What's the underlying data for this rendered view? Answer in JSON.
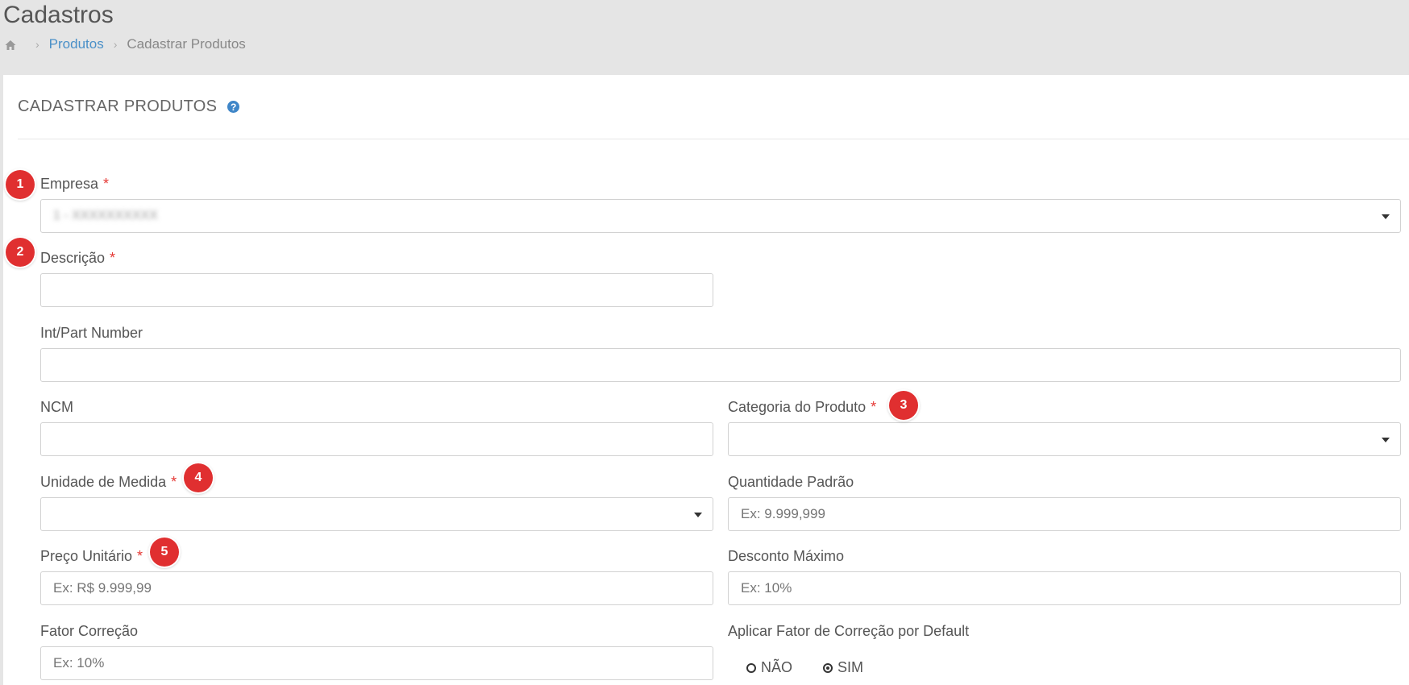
{
  "header": {
    "title": "Cadastros",
    "breadcrumb": {
      "link": "Produtos",
      "current": "Cadastrar Produtos"
    }
  },
  "panel": {
    "title": "CADASTRAR PRODUTOS",
    "help_glyph": "?"
  },
  "fields": {
    "empresa": {
      "label": "Empresa",
      "value": "1 - XXXXXXXXXX",
      "badge": "1"
    },
    "descricao": {
      "label": "Descrição",
      "placeholder": "",
      "badge": "2"
    },
    "part_number": {
      "label": "Int/Part Number",
      "placeholder": ""
    },
    "ncm": {
      "label": "NCM",
      "placeholder": ""
    },
    "categoria": {
      "label": "Categoria do Produto",
      "value": "",
      "badge": "3"
    },
    "unidade": {
      "label": "Unidade de Medida",
      "value": "",
      "badge": "4"
    },
    "quantidade": {
      "label": "Quantidade Padrão",
      "placeholder": "Ex: 9.999,999"
    },
    "preco": {
      "label": "Preço Unitário",
      "placeholder": "Ex: R$ 9.999,99",
      "badge": "5"
    },
    "desconto": {
      "label": "Desconto Máximo",
      "placeholder": "Ex: 10%"
    },
    "fator": {
      "label": "Fator Correção",
      "placeholder": "Ex: 10%"
    },
    "aplicar": {
      "label": "Aplicar Fator de Correção por Default",
      "options": [
        {
          "label": "NÃO",
          "checked": false
        },
        {
          "label": "SIM",
          "checked": true
        }
      ]
    },
    "required_mark": "*"
  },
  "colors": {
    "link": "#4a90c8",
    "required": "#e53935",
    "badge": "#e02f30",
    "help_icon": "#3f86c8"
  },
  "icons": {
    "home": "home-icon",
    "help": "help-icon",
    "caret": "caret-down-icon"
  }
}
